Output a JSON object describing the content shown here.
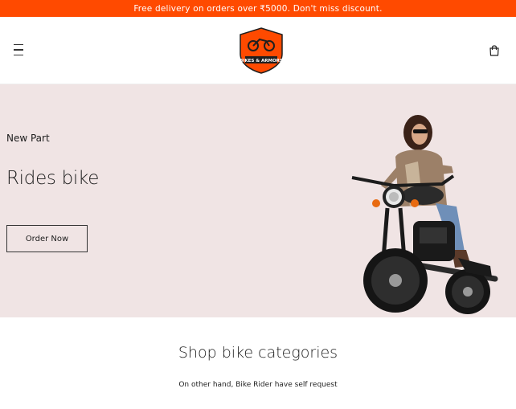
{
  "announcement": {
    "text": "Free delivery on orders over ₹5000. Don't miss discount."
  },
  "header": {
    "logo_text": "BIKES & ARMORS",
    "colors": {
      "accent": "#ff4a00",
      "logo_dark": "#1f1f1f"
    }
  },
  "hero": {
    "subtitle": "New Part",
    "title": "Rides bike",
    "button_label": "Order Now",
    "background": "#f0e4e4"
  },
  "section": {
    "title": "Shop bike categories",
    "subtitle": "On other hand, Bike Rider have self request"
  },
  "icons": {
    "menu": "hamburger-menu-icon",
    "cart": "shopping-bag-icon"
  }
}
